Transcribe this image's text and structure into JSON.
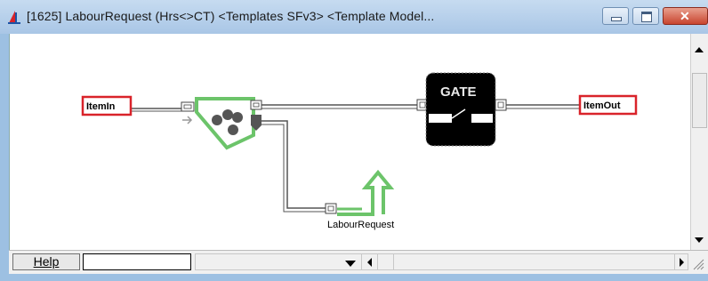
{
  "window": {
    "title": "[1625]  LabourRequest (Hrs<>CT)  <Templates SFv3>  <Template Model...",
    "close_glyph": "✕"
  },
  "diagram": {
    "nodes": {
      "item_in": "ItemIn",
      "item_out": "ItemOut",
      "gate": "GATE",
      "labour_request": "LabourRequest"
    },
    "colors": {
      "port_box_border": "#d9232a",
      "process_green": "#6cc46a",
      "gate_fill": "#000000",
      "wire": "#555555"
    }
  },
  "statusbar": {
    "help_label": "Help",
    "status_value": ""
  },
  "icons": [
    "app-icon",
    "minimize-icon",
    "maximize-icon",
    "close-icon",
    "scroll-up-arrow-icon",
    "scroll-down-arrow-icon",
    "dropdown-arrow-icon",
    "scroll-left-arrow-icon",
    "scroll-right-arrow-icon",
    "resize-grip-icon"
  ]
}
